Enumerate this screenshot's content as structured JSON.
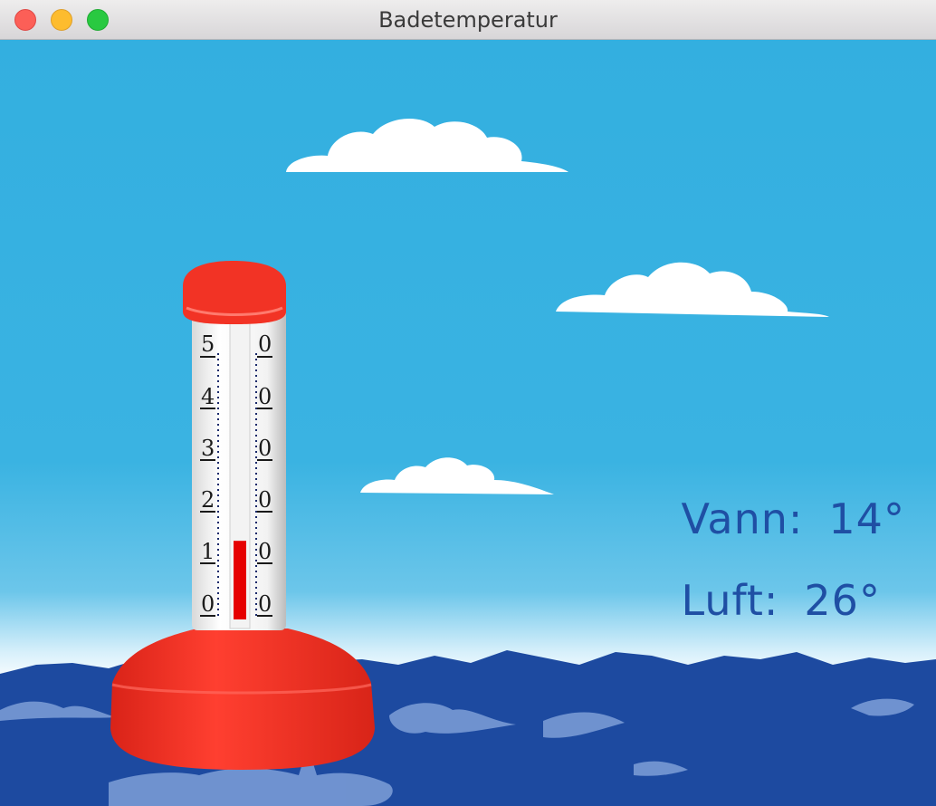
{
  "window": {
    "title": "Badetemperatur"
  },
  "thermometer": {
    "scale_labels": [
      "5",
      "4",
      "3",
      "2",
      "1",
      "0"
    ],
    "right_labels": [
      "0",
      "0",
      "0",
      "0",
      "0",
      "0"
    ],
    "scale_max": 50,
    "level": 14
  },
  "readings": {
    "water_label": "Vann:",
    "water_value": "14°",
    "air_label": "Luft:",
    "air_value": "26°"
  },
  "colors": {
    "sky_top": "#33afe0",
    "sea": "#1d4aa0",
    "buoy": "#f52f22",
    "mercury": "#e60000",
    "text": "#1f4fa4"
  }
}
